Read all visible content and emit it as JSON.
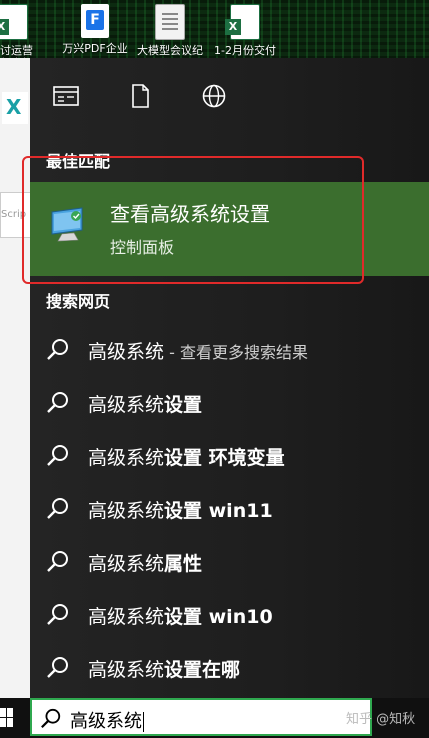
{
  "desktop": {
    "icons": [
      {
        "label": "讨运营部未报工时",
        "type": "excel"
      },
      {
        "label": "万兴PDF企业",
        "type": "pdf"
      },
      {
        "label": "大模型会议纪",
        "type": "doc"
      },
      {
        "label": "1-2月份交付",
        "type": "excel"
      }
    ],
    "left_fragment": "Scrip"
  },
  "toolbar": {
    "icons": [
      "document-view-icon",
      "file-icon",
      "globe-icon"
    ]
  },
  "best_match": {
    "heading": "最佳匹配",
    "title": "查看高级系统设置",
    "subtitle": "控制面板"
  },
  "web_search": {
    "heading": "搜索网页",
    "results": [
      {
        "prefix": "高级系统",
        "bold": "",
        "hint": " - 查看更多搜索结果"
      },
      {
        "prefix": "高级系统",
        "bold": "设置",
        "hint": ""
      },
      {
        "prefix": "高级系统",
        "bold": "设置 环境变量",
        "hint": ""
      },
      {
        "prefix": "高级系统",
        "bold": "设置 win11",
        "hint": ""
      },
      {
        "prefix": "高级系统",
        "bold": "属性",
        "hint": ""
      },
      {
        "prefix": "高级系统",
        "bold": "设置 win10",
        "hint": ""
      },
      {
        "prefix": "高级系统",
        "bold": "设置在哪",
        "hint": ""
      }
    ]
  },
  "taskbar": {
    "search_query": "高级系统",
    "watermark": "知乎 @知秋"
  },
  "colors": {
    "best_match_bg": "#3b6e2e",
    "highlight_border": "#e02a2a",
    "searchbox_border": "#2fa84f"
  }
}
